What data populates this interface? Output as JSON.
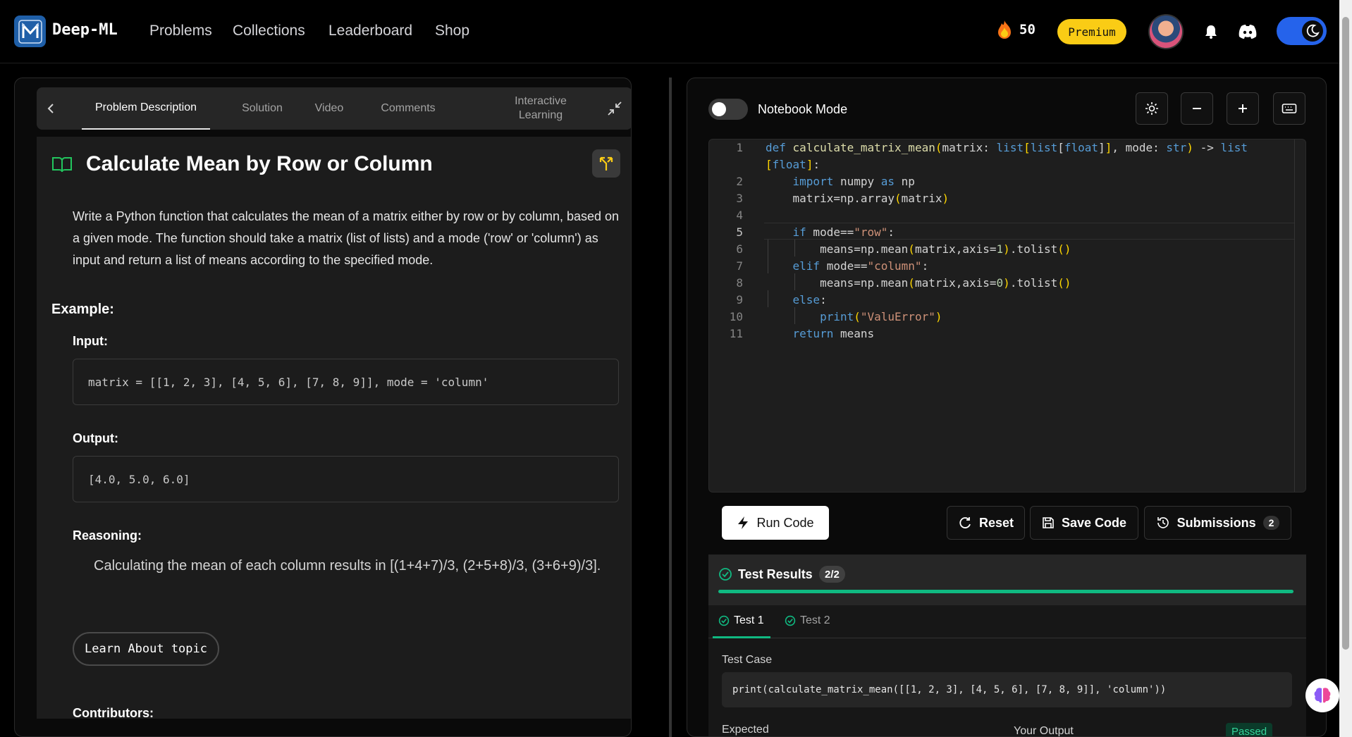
{
  "nav": {
    "logo_text": "Deep-ML",
    "links": [
      "Problems",
      "Collections",
      "Leaderboard",
      "Shop"
    ],
    "streak_count": "50",
    "premium_label": "Premium"
  },
  "left": {
    "tabs": [
      "Problem Description",
      "Solution",
      "Video",
      "Comments",
      "Interactive Learning"
    ],
    "title": "Calculate Mean by Row or Column",
    "description": "Write a Python function that calculates the mean of a matrix either by row or by column, based on a given mode. The function should take a matrix (list of lists) and a mode ('row' or 'column') as input and return a list of means according to the specified mode.",
    "example_heading": "Example:",
    "input_label": "Input:",
    "input_code": "matrix = [[1, 2, 3], [4, 5, 6], [7, 8, 9]], mode = 'column'",
    "output_label": "Output:",
    "output_code": "[4.0, 5.0, 6.0]",
    "reasoning_label": "Reasoning:",
    "reasoning_text": "Calculating the mean of each column results in [(1+4+7)/3, (2+5+8)/3, (3+6+9)/3].",
    "learn_button": "Learn About topic",
    "contributors_label": "Contributors:"
  },
  "right": {
    "notebook_label": "Notebook Mode",
    "line_numbers": [
      "1",
      "2",
      "3",
      "4",
      "5",
      "6",
      "7",
      "8",
      "9",
      "10",
      "11"
    ],
    "buttons": {
      "run": "Run Code",
      "reset": "Reset",
      "save": "Save Code",
      "submissions": "Submissions",
      "submissions_count": "2"
    },
    "results": {
      "title": "Test Results",
      "score": "2/2",
      "progress": 1.0,
      "tabs": [
        "Test 1",
        "Test 2"
      ],
      "test_case_label": "Test Case",
      "test_case_code": "print(calculate_matrix_mean([[1, 2, 3], [4, 5, 6], [7, 8, 9]], 'column'))",
      "expected_label": "Expected",
      "your_output_label": "Your Output",
      "status": "Passed"
    }
  },
  "colors": {
    "accent_blue": "#2563eb",
    "premium_yellow": "#facc15",
    "success_green": "#10b981"
  }
}
